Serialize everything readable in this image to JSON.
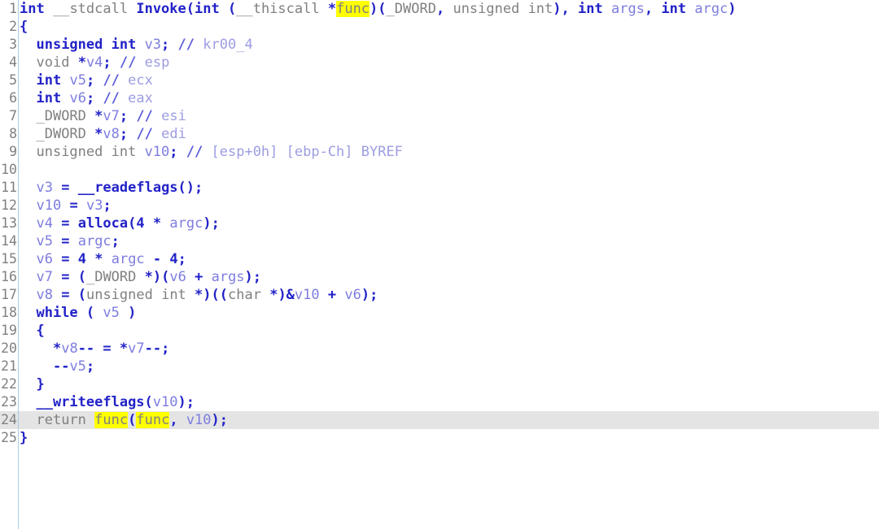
{
  "app": {
    "view_name": "pseudocode-view",
    "function_name": "Invoke"
  },
  "editor": {
    "total_lines": 25,
    "current_line": 24,
    "highlighted_token": "func",
    "colors": {
      "background": "#ffffff",
      "keyword": "#2222c8",
      "type_gray": "#808080",
      "variable": "#7d7de0",
      "comment": "#9d9de2",
      "comment_marker": "#5a5ad8",
      "search_highlight": "#ffff00",
      "current_line": "#e4e4e4",
      "gutter_text": "#808080",
      "gutter_rule": "#a8cce4"
    }
  },
  "lines": [
    {
      "n": "1",
      "text": "int __stdcall Invoke(int (__thiscall *func)(_DWORD, unsigned int), int args, int argc)"
    },
    {
      "n": "2",
      "text": "{"
    },
    {
      "n": "3",
      "text": "  unsigned int v3; // kr00_4"
    },
    {
      "n": "4",
      "text": "  void *v4; // esp"
    },
    {
      "n": "5",
      "text": "  int v5; // ecx"
    },
    {
      "n": "6",
      "text": "  int v6; // eax"
    },
    {
      "n": "7",
      "text": "  _DWORD *v7; // esi"
    },
    {
      "n": "8",
      "text": "  _DWORD *v8; // edi"
    },
    {
      "n": "9",
      "text": "  unsigned int v10; // [esp+0h] [ebp-Ch] BYREF"
    },
    {
      "n": "10",
      "text": ""
    },
    {
      "n": "11",
      "text": "  v3 = __readeflags();"
    },
    {
      "n": "12",
      "text": "  v10 = v3;"
    },
    {
      "n": "13",
      "text": "  v4 = alloca(4 * argc);"
    },
    {
      "n": "14",
      "text": "  v5 = argc;"
    },
    {
      "n": "15",
      "text": "  v6 = 4 * argc - 4;"
    },
    {
      "n": "16",
      "text": "  v7 = (_DWORD *)(v6 + args);"
    },
    {
      "n": "17",
      "text": "  v8 = (unsigned int *)((char *)&v10 + v6);"
    },
    {
      "n": "18",
      "text": "  while ( v5 )"
    },
    {
      "n": "19",
      "text": "  {"
    },
    {
      "n": "20",
      "text": "    *v8-- = *v7--;"
    },
    {
      "n": "21",
      "text": "    --v5;"
    },
    {
      "n": "22",
      "text": "  }"
    },
    {
      "n": "23",
      "text": "  __writeeflags(v10);"
    },
    {
      "n": "24",
      "text": "  return func(func, v10);"
    },
    {
      "n": "25",
      "text": "}"
    }
  ],
  "markup": {
    "l1": "<span class=\"kw\">int</span> <span class=\"typ\">__stdcall</span> <span class=\"kw\">Invoke</span><span class=\"kw\">(</span><span class=\"kw\">int</span> <span class=\"kw\">(</span><span class=\"typ\">__thiscall</span> <span class=\"kw\">*</span><span class=\"hl\">func</span><span class=\"kw\">)(</span><span class=\"typ\">_DWORD</span><span class=\"kw\">,</span> <span class=\"typ\">unsigned int</span><span class=\"kw\">),</span> <span class=\"kw\">int</span> <span class=\"var\">args</span><span class=\"kw\">,</span> <span class=\"kw\">int</span> <span class=\"var\">argc</span><span class=\"kw\">)</span>",
    "l2": "<span class=\"kw\">{</span>",
    "l3": "  <span class=\"kw\">unsigned int</span> <span class=\"var\">v3</span><span class=\"kw\">;</span> <span class=\"cmtm\">//</span> <span class=\"cmt\">kr00_4</span>",
    "l4": "  <span class=\"typ\">void</span> <span class=\"kw\">*</span><span class=\"var\">v4</span><span class=\"kw\">;</span> <span class=\"cmtm\">//</span> <span class=\"cmt\">esp</span>",
    "l5": "  <span class=\"kw\">int</span> <span class=\"var\">v5</span><span class=\"kw\">;</span> <span class=\"cmtm\">//</span> <span class=\"cmt\">ecx</span>",
    "l6": "  <span class=\"kw\">int</span> <span class=\"var\">v6</span><span class=\"kw\">;</span> <span class=\"cmtm\">//</span> <span class=\"cmt\">eax</span>",
    "l7": "  <span class=\"typ\">_DWORD</span> <span class=\"kw\">*</span><span class=\"var\">v7</span><span class=\"kw\">;</span> <span class=\"cmtm\">//</span> <span class=\"cmt\">esi</span>",
    "l8": "  <span class=\"typ\">_DWORD</span> <span class=\"kw\">*</span><span class=\"var\">v8</span><span class=\"kw\">;</span> <span class=\"cmtm\">//</span> <span class=\"cmt\">edi</span>",
    "l9": "  <span class=\"typ\">unsigned int</span> <span class=\"var\">v10</span><span class=\"kw\">;</span> <span class=\"cmtm\">//</span> <span class=\"cmt\">[esp+0h] [ebp-Ch] BYREF</span>",
    "l10": "",
    "l11": "  <span class=\"var\">v3</span> <span class=\"kw\">=</span> <span class=\"kw\">__readeflags</span><span class=\"kw\">();</span>",
    "l12": "  <span class=\"var\">v10</span> <span class=\"kw\">=</span> <span class=\"var\">v3</span><span class=\"kw\">;</span>",
    "l13": "  <span class=\"var\">v4</span> <span class=\"kw\">=</span> <span class=\"kw\">alloca</span><span class=\"kw\">(</span><span class=\"kw\">4</span> <span class=\"kw\">*</span> <span class=\"var\">argc</span><span class=\"kw\">);</span>",
    "l14": "  <span class=\"var\">v5</span> <span class=\"kw\">=</span> <span class=\"var\">argc</span><span class=\"kw\">;</span>",
    "l15": "  <span class=\"var\">v6</span> <span class=\"kw\">=</span> <span class=\"kw\">4</span> <span class=\"kw\">*</span> <span class=\"var\">argc</span> <span class=\"kw\">-</span> <span class=\"kw\">4</span><span class=\"kw\">;</span>",
    "l16": "  <span class=\"var\">v7</span> <span class=\"kw\">=</span> <span class=\"kw\">(</span><span class=\"typ\">_DWORD</span> <span class=\"kw\">*)(</span><span class=\"var\">v6</span> <span class=\"kw\">+</span> <span class=\"var\">args</span><span class=\"kw\">);</span>",
    "l17": "  <span class=\"var\">v8</span> <span class=\"kw\">=</span> <span class=\"kw\">(</span><span class=\"typ\">unsigned int</span> <span class=\"kw\">*)((</span><span class=\"typ\">char</span> <span class=\"kw\">*)&amp;</span><span class=\"var\">v10</span> <span class=\"kw\">+</span> <span class=\"var\">v6</span><span class=\"kw\">);</span>",
    "l18": "  <span class=\"kw\">while</span> <span class=\"kw\">(</span> <span class=\"var\">v5</span> <span class=\"kw\">)</span>",
    "l19": "  <span class=\"kw\">{</span>",
    "l20": "    <span class=\"kw\">*</span><span class=\"var\">v8</span><span class=\"kw\">--</span> <span class=\"kw\">=</span> <span class=\"kw\">*</span><span class=\"var\">v7</span><span class=\"kw\">--;</span>",
    "l21": "    <span class=\"kw\">--</span><span class=\"var\">v5</span><span class=\"kw\">;</span>",
    "l22": "  <span class=\"kw\">}</span>",
    "l23": "  <span class=\"kw\">__writeeflags</span><span class=\"kw\">(</span><span class=\"var\">v10</span><span class=\"kw\">);</span>",
    "l24": "  <span class=\"typ\">return</span> <span class=\"hl\">func</span><span class=\"kw\">(</span><span class=\"hl\">func</span><span class=\"kw\">,</span> <span class=\"var\">v10</span><span class=\"kw\">);</span>",
    "l25": "<span class=\"kw\">}</span>"
  }
}
